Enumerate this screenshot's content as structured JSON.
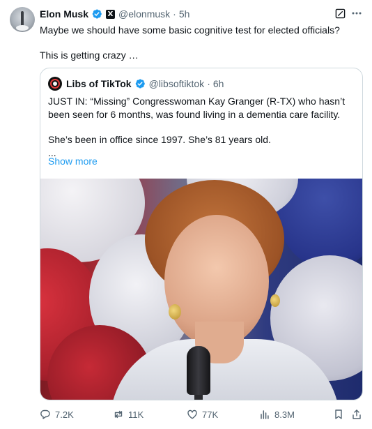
{
  "author": {
    "name": "Elon Musk",
    "handle": "@elonmusk",
    "time": "5h",
    "avatar_icon": "person-avatar-icon",
    "verified_color": "#1d9bf0"
  },
  "tweet": {
    "line1": "Maybe we should have some basic cognitive test for elected officials?",
    "line2": "This is getting crazy …"
  },
  "quote": {
    "author_name": "Libs of TikTok",
    "handle": "@libsoftiktok",
    "time": "6h",
    "para1": "JUST IN: “Missing” Congresswoman Kay Granger (R-TX) who hasn’t been seen for 6 months, was found living in a dementia care facility.",
    "para2": "She’s been in office since 1997. She’s 81 years old.",
    "ellipsis": "...",
    "show_more": "Show more"
  },
  "actions": {
    "replies": "7.2K",
    "reposts": "11K",
    "likes": "77K",
    "views": "8.3M"
  },
  "colors": {
    "accent": "#1d9bf0",
    "secondary_text": "#536471",
    "border": "#cfd9de"
  }
}
